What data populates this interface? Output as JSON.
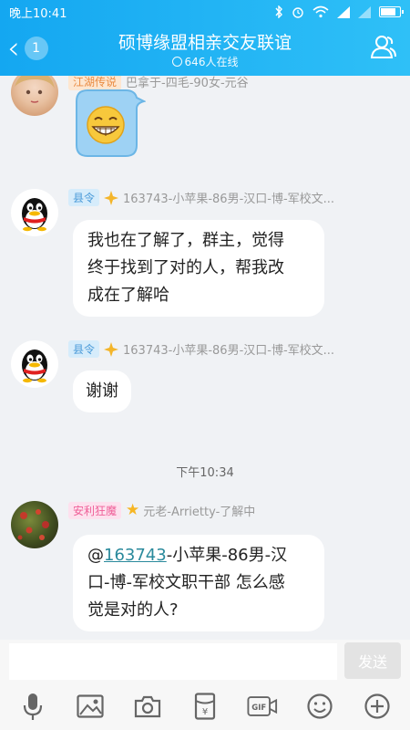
{
  "status": {
    "time": "晚上10:41"
  },
  "header": {
    "back_count": "1",
    "title": "硕博缘盟相亲交友联谊",
    "online": "646人在线"
  },
  "messages": [
    {
      "tag": "江湖传说",
      "sender": "巴拿于-四毛-90女-元谷",
      "content_type": "sticker",
      "sticker": "grinning-face-sticker"
    },
    {
      "tag": "县令",
      "sender": "163743-小苹果-86男-汉口-博-军校文...",
      "lines": [
        "我也在了解了，群主，觉得",
        "终于找到了对的人，帮我改",
        "成在了解哈"
      ]
    },
    {
      "tag": "县令",
      "sender": "163743-小苹果-86男-汉口-博-军校文...",
      "lines": [
        "谢谢"
      ]
    },
    {
      "time": "下午10:34"
    },
    {
      "tag": "安利狂魔",
      "sender": "元老-Arrietty-了解中",
      "mention_prefix": "@",
      "mention": "163743",
      "line1_rest": "-小苹果-86男-汉",
      "line2": "口-博-军校文职干部 怎么感",
      "line3": "觉是对的人?"
    }
  ],
  "composer": {
    "input_value": "",
    "send_label": "发送"
  },
  "toolbar": {
    "icons": [
      "microphone-icon",
      "image-icon",
      "camera-icon",
      "red-packet-icon",
      "gif-icon",
      "emoji-icon",
      "plus-icon"
    ],
    "gif_label": "GIF",
    "redpacket_glyph": "¥"
  },
  "colors": {
    "header": "#1faef3",
    "tag_blue": "#4a9ad8",
    "tag_pink": "#ef5f98",
    "mention": "#2a8a9c"
  }
}
